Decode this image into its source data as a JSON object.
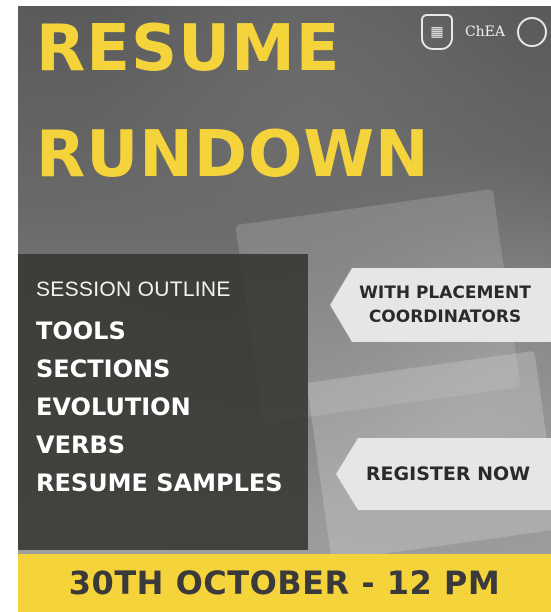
{
  "title": {
    "line1": "RESUME",
    "line2": "RUNDOWN"
  },
  "logos": {
    "emblem_icon": "crest-emblem-icon",
    "chea_text": "ChEA",
    "seal_icon": "round-seal-icon"
  },
  "outline": {
    "heading": "SESSION OUTLINE",
    "items": [
      "TOOLS",
      "SECTIONS",
      "EVOLUTION",
      "VERBS",
      "RESUME SAMPLES"
    ]
  },
  "tags": {
    "placement_line1": "WITH PLACEMENT",
    "placement_line2": "COORDINATORS",
    "register": "REGISTER NOW"
  },
  "footer": {
    "date_time": "30TH OCTOBER - 12 PM"
  },
  "colors": {
    "accent_yellow": "#f5d33a",
    "panel_dark": "#373532",
    "tag_grey": "#e6e6e6"
  }
}
